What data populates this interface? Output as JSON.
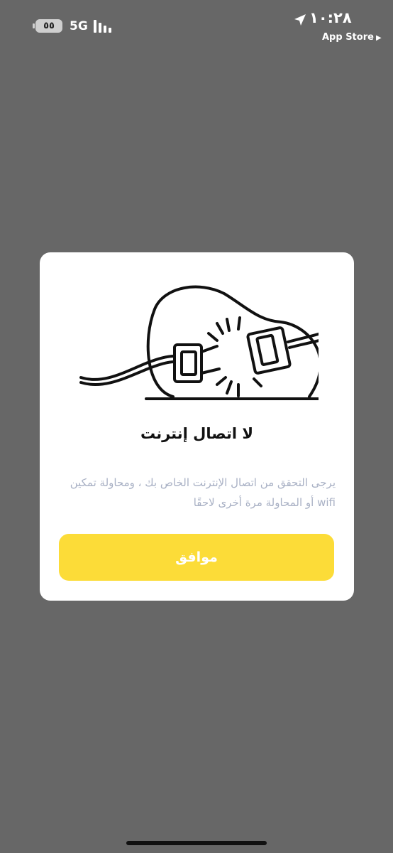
{
  "status_bar": {
    "battery": "٥٥",
    "network": "5G",
    "time": "١٠:٢٨",
    "back_app": "App Store"
  },
  "dialog": {
    "title": "لا اتصال إنترنت",
    "message": "يرجى التحقق من اتصال الإنترنت الخاص بك ، ومحاولة تمكين wifi أو المحاولة مرة أخرى لاحقًا",
    "ok_label": "موافق",
    "icon": "unplugged-plug-icon"
  },
  "colors": {
    "overlay": "#676767",
    "accent": "#fcdc38",
    "message_text": "#a8b0c4"
  }
}
